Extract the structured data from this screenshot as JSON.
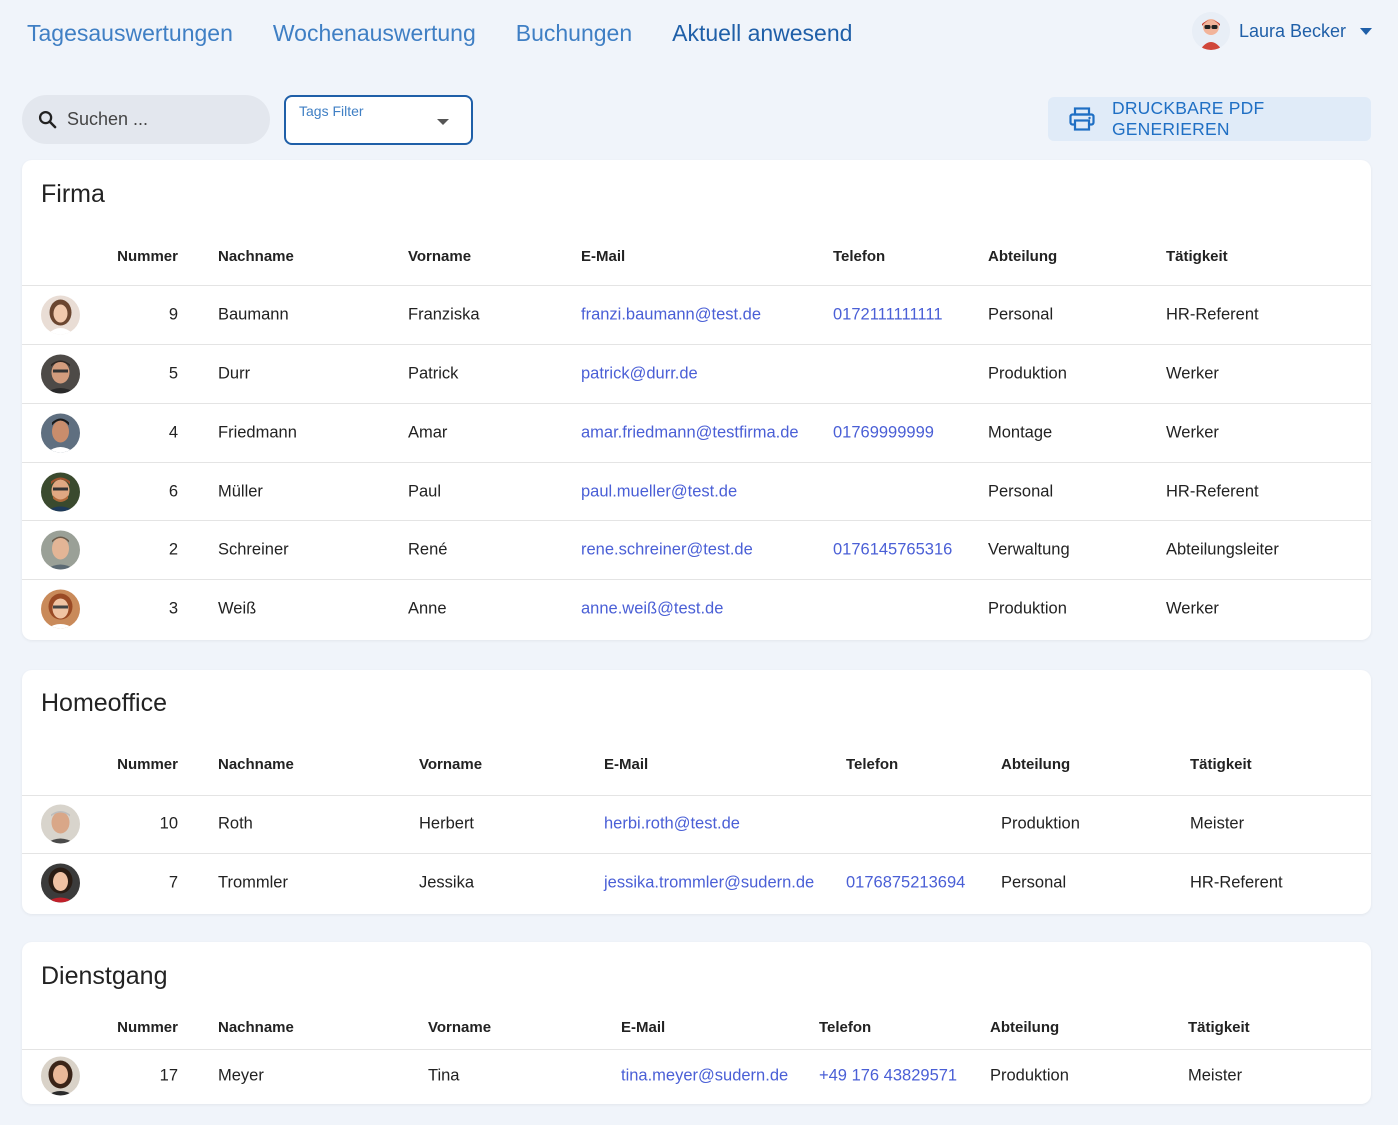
{
  "nav": {
    "tabs": [
      {
        "label": "Tagesauswertungen"
      },
      {
        "label": "Wochenauswertung"
      },
      {
        "label": "Buchungen"
      },
      {
        "label": "Aktuell anwesend"
      }
    ],
    "active_tab": "Aktuell anwesend",
    "user": {
      "name": "Laura Becker",
      "avatar_icon": "user-avatar-icon"
    }
  },
  "toolbar": {
    "search_placeholder": "Suchen ...",
    "tags_filter_label": "Tags Filter",
    "pdf_button_label": "DRUCKBARE PDF GENERIEREN",
    "pdf_icon": "printer-icon"
  },
  "colors": {
    "accent": "#1f5fa8",
    "link": "#4a5fd6",
    "background": "#f0f4fa"
  },
  "sections": [
    {
      "title": "Firma",
      "headers": [
        "Nummer",
        "Nachname",
        "Vorname",
        "E-Mail",
        "Telefon",
        "Abteilung",
        "Tätigkeit"
      ],
      "rows": [
        {
          "nummer": "9",
          "nachname": "Baumann",
          "vorname": "Franziska",
          "email": "franzi.baumann@test.de",
          "telefon": "0172111111111",
          "abteilung": "Personal",
          "taetigkeit": "HR-Referent"
        },
        {
          "nummer": "5",
          "nachname": "Durr",
          "vorname": "Patrick",
          "email": "patrick@durr.de",
          "telefon": "",
          "abteilung": "Produktion",
          "taetigkeit": "Werker"
        },
        {
          "nummer": "4",
          "nachname": "Friedmann",
          "vorname": "Amar",
          "email": "amar.friedmann@testfirma.de",
          "telefon": "01769999999",
          "abteilung": "Montage",
          "taetigkeit": "Werker"
        },
        {
          "nummer": "6",
          "nachname": "Müller",
          "vorname": "Paul",
          "email": "paul.mueller@test.de",
          "telefon": "",
          "abteilung": "Personal",
          "taetigkeit": "HR-Referent"
        },
        {
          "nummer": "2",
          "nachname": "Schreiner",
          "vorname": "René",
          "email": "rene.schreiner@test.de",
          "telefon": "0176145765316",
          "abteilung": "Verwaltung",
          "taetigkeit": "Abteilungsleiter"
        },
        {
          "nummer": "3",
          "nachname": "Weiß",
          "vorname": "Anne",
          "email": "anne.weiß@test.de",
          "telefon": "",
          "abteilung": "Produktion",
          "taetigkeit": "Werker"
        }
      ]
    },
    {
      "title": "Homeoffice",
      "headers": [
        "Nummer",
        "Nachname",
        "Vorname",
        "E-Mail",
        "Telefon",
        "Abteilung",
        "Tätigkeit"
      ],
      "rows": [
        {
          "nummer": "10",
          "nachname": "Roth",
          "vorname": "Herbert",
          "email": "herbi.roth@test.de",
          "telefon": "",
          "abteilung": "Produktion",
          "taetigkeit": "Meister"
        },
        {
          "nummer": "7",
          "nachname": "Trommler",
          "vorname": "Jessika",
          "email": "jessika.trommler@sudern.de",
          "telefon": "0176875213694",
          "abteilung": "Personal",
          "taetigkeit": "HR-Referent"
        }
      ]
    },
    {
      "title": "Dienstgang",
      "headers": [
        "Nummer",
        "Nachname",
        "Vorname",
        "E-Mail",
        "Telefon",
        "Abteilung",
        "Tätigkeit"
      ],
      "rows": [
        {
          "nummer": "17",
          "nachname": "Meyer",
          "vorname": "Tina",
          "email": "tina.meyer@sudern.de",
          "telefon": "+49 176 43829571",
          "abteilung": "Produktion",
          "taetigkeit": "Meister"
        }
      ]
    }
  ]
}
